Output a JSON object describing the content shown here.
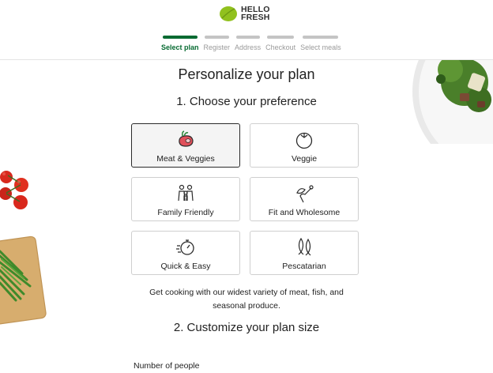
{
  "brand": {
    "line1": "HELLO",
    "line2": "FRESH",
    "color": "#91c11e"
  },
  "progress": {
    "steps": [
      {
        "label": "Select plan",
        "active": true
      },
      {
        "label": "Register",
        "active": false
      },
      {
        "label": "Address",
        "active": false
      },
      {
        "label": "Checkout",
        "active": false
      },
      {
        "label": "Select meals",
        "active": false
      }
    ]
  },
  "page": {
    "title": "Personalize your plan",
    "section1": "1. Choose your preference",
    "section2": "2. Customize your plan size",
    "description": "Get cooking with our widest variety of meat, fish, and seasonal produce.",
    "people_label": "Number of people"
  },
  "preferences": [
    {
      "label": "Meat & Veggies",
      "icon": "meat-veggies-icon",
      "selected": true
    },
    {
      "label": "Veggie",
      "icon": "tomato-icon",
      "selected": false
    },
    {
      "label": "Family Friendly",
      "icon": "family-icon",
      "selected": false
    },
    {
      "label": "Fit and Wholesome",
      "icon": "fit-wholesome-icon",
      "selected": false
    },
    {
      "label": "Quick & Easy",
      "icon": "stopwatch-icon",
      "selected": false
    },
    {
      "label": "Pescatarian",
      "icon": "fish-icon",
      "selected": false
    }
  ],
  "colors": {
    "accent": "#066a31",
    "selected_border": "#2b2b2b"
  }
}
